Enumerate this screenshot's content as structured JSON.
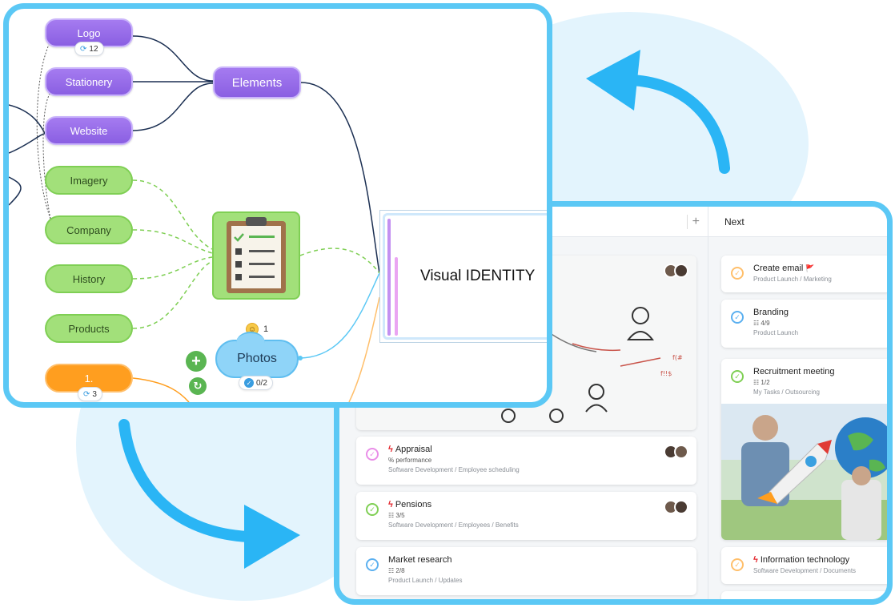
{
  "mindmap": {
    "central_node": "Visual IDENTITY",
    "elements_node": "Elements",
    "purple_nodes": [
      "Logo",
      "Stationery",
      "Website"
    ],
    "logo_badge": "12",
    "green_nodes": [
      "Imagery",
      "Company",
      "History",
      "Products"
    ],
    "orange_node": "1.",
    "orange_badge": "3",
    "photos_node": "Photos",
    "photos_badge": "0/2",
    "emoji_count": "1"
  },
  "task_board": {
    "columns": [
      {
        "label": "+"
      },
      {
        "label": "Next"
      }
    ],
    "left_column_tasks": [
      {
        "title": "Appraisal",
        "priority": true,
        "sub": "% performance",
        "path": "Software Development / Employee scheduling",
        "check_color": "#e98ee8"
      },
      {
        "title": "Pensions",
        "priority": true,
        "sub": "☷ 3/5",
        "path": "Software Development / Employees / Benefits",
        "check_color": "#7fcf54"
      },
      {
        "title": "Market research",
        "priority": false,
        "sub": "☷ 2/8",
        "path": "Product Launch / Updates",
        "check_color": "#5bb0f0"
      }
    ],
    "next_column_tasks": [
      {
        "title": "Create email",
        "priority": false,
        "flag": "🚩",
        "sub": "",
        "path": "Product Launch / Marketing",
        "check_color": "#ffbf6b"
      },
      {
        "title": "Branding",
        "priority": false,
        "sub": "☷ 4/9",
        "path": "Product Launch",
        "check_color": "#5bb0f0"
      },
      {
        "title": "Recruitment meeting",
        "priority": false,
        "sub": "☷ 1/2",
        "path": "My Tasks / Outsourcing",
        "check_color": "#7fcf54"
      },
      {
        "title": "Information technology",
        "priority": true,
        "sub": "",
        "path": "Software Development / Documents",
        "check_color": "#ffbf6b"
      }
    ]
  },
  "colors": {
    "frame": "#5bc8f5",
    "arrow": "#2ab5f5",
    "purple": "#9b6dea",
    "green": "#a2e07a",
    "orange": "#ff9e1f",
    "background_blob": "#e3f4fd"
  },
  "icons": [
    "curved-arrow-icon",
    "clipboard-checklist-icon",
    "plus-icon",
    "sync-icon",
    "checkmark-icon",
    "lightning-bolt-icon",
    "flag-icon",
    "emoji-smile-icon"
  ]
}
